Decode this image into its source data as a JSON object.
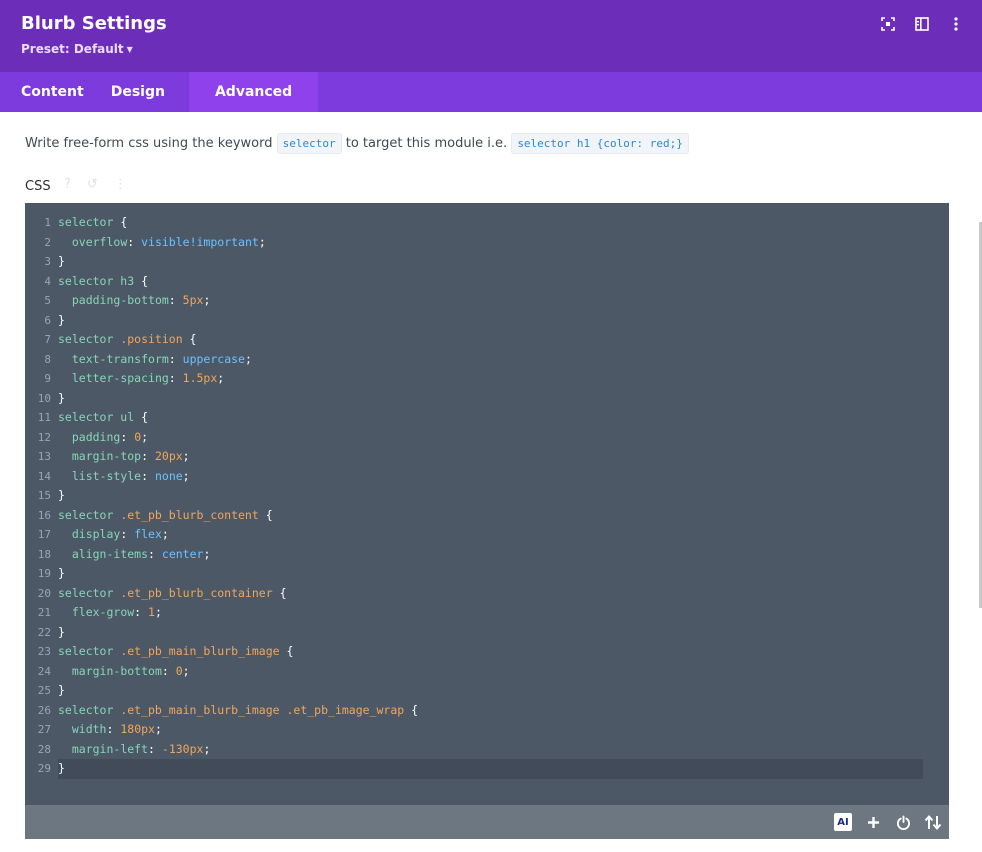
{
  "header": {
    "title": "Blurb Settings",
    "preset_label": "Preset: Default",
    "icons": [
      "expand-icon",
      "sidebar-toggle-icon",
      "more-vertical-icon"
    ]
  },
  "tabs": [
    {
      "label": "Content",
      "active": false
    },
    {
      "label": "Design",
      "active": false
    },
    {
      "label": "Advanced",
      "active": true
    }
  ],
  "description": {
    "text_before": "Write free-form css using the keyword",
    "keyword": "selector",
    "text_middle": "to target this module i.e.",
    "example": "selector h1 {color: red;}"
  },
  "css_field": {
    "label": "CSS",
    "label_icons": [
      "help-icon",
      "reset-icon",
      "more-icon"
    ]
  },
  "code": {
    "line_numbers": [
      "1",
      "2",
      "3",
      "4",
      "5",
      "6",
      "7",
      "8",
      "9",
      "10",
      "11",
      "12",
      "13",
      "14",
      "15",
      "16",
      "17",
      "18",
      "19",
      "20",
      "21",
      "22",
      "23",
      "24",
      "25",
      "26",
      "27",
      "28",
      "29"
    ],
    "lines": [
      [
        {
          "t": "sel",
          "v": "selector"
        },
        {
          "t": "punc",
          "v": " {"
        }
      ],
      [
        {
          "t": "punc",
          "v": "  "
        },
        {
          "t": "prop",
          "v": "overflow"
        },
        {
          "t": "punc",
          "v": ": "
        },
        {
          "t": "kw",
          "v": "visible!important"
        },
        {
          "t": "punc",
          "v": ";"
        }
      ],
      [
        {
          "t": "punc",
          "v": "}"
        }
      ],
      [
        {
          "t": "sel",
          "v": "selector h3"
        },
        {
          "t": "punc",
          "v": " {"
        }
      ],
      [
        {
          "t": "punc",
          "v": "  "
        },
        {
          "t": "prop",
          "v": "padding-bottom"
        },
        {
          "t": "punc",
          "v": ": "
        },
        {
          "t": "num",
          "v": "5px"
        },
        {
          "t": "punc",
          "v": ";"
        }
      ],
      [
        {
          "t": "punc",
          "v": "}"
        }
      ],
      [
        {
          "t": "sel",
          "v": "selector "
        },
        {
          "t": "cls",
          "v": ".position"
        },
        {
          "t": "punc",
          "v": " {"
        }
      ],
      [
        {
          "t": "punc",
          "v": "  "
        },
        {
          "t": "prop",
          "v": "text-transform"
        },
        {
          "t": "punc",
          "v": ": "
        },
        {
          "t": "kw",
          "v": "uppercase"
        },
        {
          "t": "punc",
          "v": ";"
        }
      ],
      [
        {
          "t": "punc",
          "v": "  "
        },
        {
          "t": "prop",
          "v": "letter-spacing"
        },
        {
          "t": "punc",
          "v": ": "
        },
        {
          "t": "num",
          "v": "1.5px"
        },
        {
          "t": "punc",
          "v": ";"
        }
      ],
      [
        {
          "t": "punc",
          "v": "}"
        }
      ],
      [
        {
          "t": "sel",
          "v": "selector ul"
        },
        {
          "t": "punc",
          "v": " {"
        }
      ],
      [
        {
          "t": "punc",
          "v": "  "
        },
        {
          "t": "prop",
          "v": "padding"
        },
        {
          "t": "punc",
          "v": ": "
        },
        {
          "t": "num",
          "v": "0"
        },
        {
          "t": "punc",
          "v": ";"
        }
      ],
      [
        {
          "t": "punc",
          "v": "  "
        },
        {
          "t": "prop",
          "v": "margin-top"
        },
        {
          "t": "punc",
          "v": ": "
        },
        {
          "t": "num",
          "v": "20px"
        },
        {
          "t": "punc",
          "v": ";"
        }
      ],
      [
        {
          "t": "punc",
          "v": "  "
        },
        {
          "t": "prop",
          "v": "list-style"
        },
        {
          "t": "punc",
          "v": ": "
        },
        {
          "t": "kw",
          "v": "none"
        },
        {
          "t": "punc",
          "v": ";"
        }
      ],
      [
        {
          "t": "punc",
          "v": "}"
        }
      ],
      [
        {
          "t": "sel",
          "v": "selector "
        },
        {
          "t": "cls",
          "v": ".et_pb_blurb_content"
        },
        {
          "t": "punc",
          "v": " {"
        }
      ],
      [
        {
          "t": "punc",
          "v": "  "
        },
        {
          "t": "prop",
          "v": "display"
        },
        {
          "t": "punc",
          "v": ": "
        },
        {
          "t": "kw",
          "v": "flex"
        },
        {
          "t": "punc",
          "v": ";"
        }
      ],
      [
        {
          "t": "punc",
          "v": "  "
        },
        {
          "t": "prop",
          "v": "align-items"
        },
        {
          "t": "punc",
          "v": ": "
        },
        {
          "t": "kw",
          "v": "center"
        },
        {
          "t": "punc",
          "v": ";"
        }
      ],
      [
        {
          "t": "punc",
          "v": "}"
        }
      ],
      [
        {
          "t": "sel",
          "v": "selector "
        },
        {
          "t": "cls",
          "v": ".et_pb_blurb_container"
        },
        {
          "t": "punc",
          "v": " {"
        }
      ],
      [
        {
          "t": "punc",
          "v": "  "
        },
        {
          "t": "prop",
          "v": "flex-grow"
        },
        {
          "t": "punc",
          "v": ": "
        },
        {
          "t": "num",
          "v": "1"
        },
        {
          "t": "punc",
          "v": ";"
        }
      ],
      [
        {
          "t": "punc",
          "v": "}"
        }
      ],
      [
        {
          "t": "sel",
          "v": "selector "
        },
        {
          "t": "cls",
          "v": ".et_pb_main_blurb_image"
        },
        {
          "t": "punc",
          "v": " {"
        }
      ],
      [
        {
          "t": "punc",
          "v": "  "
        },
        {
          "t": "prop",
          "v": "margin-bottom"
        },
        {
          "t": "punc",
          "v": ": "
        },
        {
          "t": "num",
          "v": "0"
        },
        {
          "t": "punc",
          "v": ";"
        }
      ],
      [
        {
          "t": "punc",
          "v": "}"
        }
      ],
      [
        {
          "t": "sel",
          "v": "selector "
        },
        {
          "t": "cls",
          "v": ".et_pb_main_blurb_image .et_pb_image_wrap"
        },
        {
          "t": "punc",
          "v": " {"
        }
      ],
      [
        {
          "t": "punc",
          "v": "  "
        },
        {
          "t": "prop",
          "v": "width"
        },
        {
          "t": "punc",
          "v": ": "
        },
        {
          "t": "num",
          "v": "180px"
        },
        {
          "t": "punc",
          "v": ";"
        }
      ],
      [
        {
          "t": "punc",
          "v": "  "
        },
        {
          "t": "prop",
          "v": "margin-left"
        },
        {
          "t": "punc",
          "v": ": "
        },
        {
          "t": "num",
          "v": "-130px"
        },
        {
          "t": "punc",
          "v": ";"
        }
      ],
      [
        {
          "t": "punc",
          "v": "}"
        }
      ]
    ]
  },
  "footer": {
    "ai_label": "AI",
    "icons": [
      "ai-icon",
      "plus-icon",
      "power-icon",
      "sort-icon"
    ]
  },
  "colors": {
    "header_bg": "#6c2eb9",
    "tabs_bg": "#7d3bde",
    "active_tab_bg": "#8f42ec",
    "editor_bg": "#4c5866"
  }
}
